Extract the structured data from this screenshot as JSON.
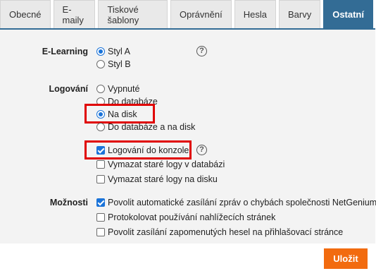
{
  "tabs": [
    {
      "label": "Obecné",
      "active": false
    },
    {
      "label": "E-maily",
      "active": false
    },
    {
      "label": "Tiskové šablony",
      "active": false
    },
    {
      "label": "Oprávnění",
      "active": false
    },
    {
      "label": "Hesla",
      "active": false
    },
    {
      "label": "Barvy",
      "active": false
    },
    {
      "label": "Ostatní",
      "active": true
    }
  ],
  "elearning": {
    "label": "E-Learning",
    "options": [
      {
        "label": "Styl A",
        "selected": true
      },
      {
        "label": "Styl B",
        "selected": false
      }
    ],
    "help_icon": "question-circle-icon"
  },
  "logging": {
    "label": "Logování",
    "options": [
      {
        "label": "Vypnuté",
        "selected": false
      },
      {
        "label": "Do databáze",
        "selected": false
      },
      {
        "label": "Na disk",
        "selected": true
      },
      {
        "label": "Do databáze a na disk",
        "selected": false
      }
    ],
    "checks": [
      {
        "label": "Logování do konzole",
        "checked": true
      },
      {
        "label": "Vymazat staré logy v databázi",
        "checked": false
      },
      {
        "label": "Vymazat staré logy na disku",
        "checked": false
      }
    ],
    "help_icon": "question-circle-icon"
  },
  "options": {
    "label": "Možnosti",
    "checks": [
      {
        "label": "Povolit automatické zasílání zpráv o chybách společnosti NetGenium",
        "checked": true
      },
      {
        "label": "Protokolovat používání nahlížecích stránek",
        "checked": false
      },
      {
        "label": "Povolit zasílání zapomenutých hesel na přihlašovací stránce",
        "checked": false
      }
    ]
  },
  "save_label": "Uložit",
  "colors": {
    "tab_active": "#336c95",
    "save_button": "#f26b0f",
    "highlight": "#e00000",
    "control_accent": "#1a73d9"
  }
}
